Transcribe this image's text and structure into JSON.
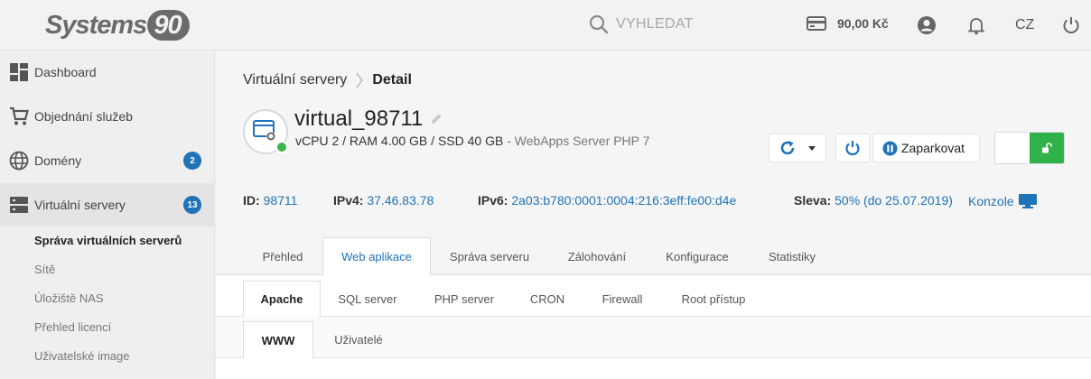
{
  "brand": {
    "name": "Systems",
    "badge": "90"
  },
  "header": {
    "search_placeholder": "VYHLEDAT",
    "credit": "90,00 Kč",
    "language": "CZ"
  },
  "sidebar": {
    "items": [
      {
        "label": "Dashboard",
        "icon": "dashboard-icon"
      },
      {
        "label": "Objednání služeb",
        "icon": "cart-icon"
      },
      {
        "label": "Domény",
        "icon": "globe-icon",
        "badge": "2"
      },
      {
        "label": "Virtuální servery",
        "icon": "server-icon",
        "badge": "13"
      }
    ],
    "subitems": [
      {
        "label": "Správa virtuálních serverů"
      },
      {
        "label": "Sítě"
      },
      {
        "label": "Úložiště NAS"
      },
      {
        "label": "Přehled licencí"
      },
      {
        "label": "Uživatelské image"
      }
    ]
  },
  "breadcrumb": {
    "parent": "Virtuální servery",
    "current": "Detail"
  },
  "server": {
    "name": "virtual_98711",
    "spec": "vCPU 2 / RAM 4.00 GB / SSD 40 GB",
    "spec_suffix": " - WebApps Server PHP 7",
    "park_label": "Zaparkovat"
  },
  "info": {
    "id_label": "ID:",
    "id_value": "98711",
    "ipv4_label": "IPv4:",
    "ipv4_value": "37.46.83.78",
    "ipv6_label": "IPv6:",
    "ipv6_value": "2a03:b780:0001:0004:216:3eff:fe00:d4e",
    "discount_label": "Sleva:",
    "discount_value": "50% (do 25.07.2019)",
    "console_label": "Konzole"
  },
  "tabs": [
    "Přehled",
    "Web aplikace",
    "Správa serveru",
    "Zálohování",
    "Konfigurace",
    "Statistiky"
  ],
  "subtabs": [
    "Apache",
    "SQL server",
    "PHP server",
    "CRON",
    "Firewall",
    "Root přístup"
  ],
  "subsubtabs": [
    "WWW",
    "Uživatelé"
  ],
  "colors": {
    "accent": "#1f73b7",
    "success": "#2fb24a"
  }
}
